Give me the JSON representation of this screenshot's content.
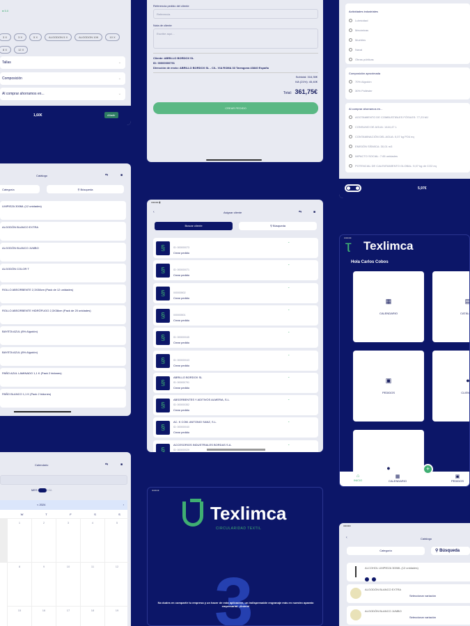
{
  "filters": {
    "chips": [
      "3 X",
      "3 X",
      "5 X",
      "ALGODON 5 X",
      "ALGODON 10K",
      "10 X",
      "8 X",
      "12 X"
    ],
    "dropdowns": [
      "Tallas",
      "Composición",
      "Al comprar ahorramos en..."
    ],
    "price": "1,60€",
    "add_label": "Añadir"
  },
  "order_form": {
    "ref_label": "Referencia pedido del cliente",
    "ref_placeholder": "Referencia",
    "notes_label": "Nota de cliente",
    "notes_placeholder": "Escribe aquí...",
    "client_line": "Cliente: ABRILLO BORDOX SL",
    "id_line": "ID: 00000000791",
    "address_line": "Dirección de envío: ABRILLO BORDOX SL - C/L. VIA ROMA 33 Tarragona 43840 España",
    "subtotal": "Subtotal: 316,35€",
    "iva": "IVA (21%): 45,40€",
    "total_label": "Total:",
    "total_value": "361,75€",
    "create_label": "CREAR PEDIDO"
  },
  "sustain": {
    "activities_title": "Actividades industriales",
    "activities": [
      "Lubricidad",
      "Mecánicas",
      "Muebles",
      "Naval",
      "Obras públicas"
    ],
    "composition_title": "Composición aproximada",
    "composition": [
      "70% Algodón",
      "30% Poliéster"
    ],
    "savings_title": "Al comprar ahorramos en...",
    "savings": [
      "AGOTAMIENTO DE COMBUSTIBLES FÓSILES: 77,23 MJ",
      "CONSUMO DE AGUA: 1444,47 L",
      "CONTAMINACIÓN DEL AGUA: 0,07 kg PO4 eq",
      "EMISIÓN SÍSMICA: 30,01 m3",
      "IMPACTO SOCIAL: 7.65 unidades",
      "POTENCIAL DE CALENTAMIENTO GLOBAL: 5,07 kg de CO2 eq"
    ],
    "price": "5,97€"
  },
  "catalog_left": {
    "title": "Catálogo",
    "category": "Categoría",
    "search": "Búsqueda",
    "items": [
      "LIMPIEZA 300ML (12 unidades)",
      "ALGODÓN BLANCO EXTRA",
      "ALGODÓN BLANCO JUMBO",
      "ALGODÓN COLOR T",
      "ROLLO ABSORBENTE 2,3X38cm (Pack de 12 unidades)",
      "ROLLO ABSORBENTE HIDRÓFUGO 2,3X38cm (Pack de 20 unidades)",
      "BAYETA AZUL (8% Algodón)",
      "BAYETA AZUL (8% Algodón)",
      "PAÑO AZUL LAMINADO 1,1 K (Pack 2 bidones)",
      "PAÑO BLANCO 1,1 K (Pack 2 bidones)"
    ]
  },
  "assign": {
    "title": "Asignar cliente",
    "tab_active": "Buscar cliente",
    "tab_search": "Búsqueda",
    "order_label": "Crear pedido",
    "clients": [
      {
        "name": "",
        "id": "ID: 000000073"
      },
      {
        "name": "",
        "id": "ID: 000000071"
      },
      {
        "name": "",
        "id": "000000502"
      },
      {
        "name": "",
        "id": "000000501"
      },
      {
        "name": "",
        "id": "ID: 000000045"
      },
      {
        "name": "",
        "id": "ID: 000000043"
      },
      {
        "name": "ABRILLO BORDOX SL",
        "id": "ID: 000000791"
      },
      {
        "name": "ABSORBENTES Y ADITIVOS ALMERIA, S.L.",
        "id": "ID: 000000352"
      },
      {
        "name": "AC. K COM. ANTONIO SANZ, S.L.",
        "id": "ID: 000000040"
      },
      {
        "name": "ACCESORIOS INDUSTRIALES BORDAS S.A.",
        "id": "ID: 000000029"
      }
    ]
  },
  "home": {
    "brand": "Texlimca",
    "greeting": "Hola Carlos Cobos",
    "tiles": [
      "CALENDARIO",
      "CATÁLOGO",
      "PEDIDOS",
      "CLIENTES",
      ""
    ],
    "nav": [
      "INICIO",
      "CALENDARIO",
      "PEDIDOS"
    ]
  },
  "calendar": {
    "title": "Calendario",
    "toggle_left": "MES",
    "toggle_right": "DÍA",
    "month": "< 2024",
    "days": [
      "W",
      "T",
      "F",
      "S",
      "S"
    ],
    "dates": [
      "1",
      "2",
      "3",
      "4",
      "5",
      "8",
      "9",
      "10",
      "11",
      "12",
      "15",
      "16",
      "17",
      "18",
      "19"
    ]
  },
  "splash": {
    "brand": "Texlimca",
    "tagline": "CIRCULARIDAD TEXTIL",
    "step": "3",
    "message": "No dudes en compartir tu empresa y un hacer de esta aplicación, un indispensable engranaje más en nuestro aparato empresarial. ¡Ánimo!"
  },
  "catalog_right": {
    "title": "Catálogo",
    "category": "Categoría",
    "search": "Búsqueda",
    "items": [
      {
        "name": "ALCOHOL LIMPIEZA 300ML (12 unidades)",
        "sub": ""
      },
      {
        "name": "ALGODÓN BLANCO EXTRA",
        "sub": "Seleccionar variación"
      },
      {
        "name": "ALGODÓN BLANCO JUMBO",
        "sub": "Seleccionar variación"
      }
    ]
  },
  "colors": {
    "navy": "#0c1668",
    "green": "#3fae72",
    "panel": "#e8eaf2"
  }
}
